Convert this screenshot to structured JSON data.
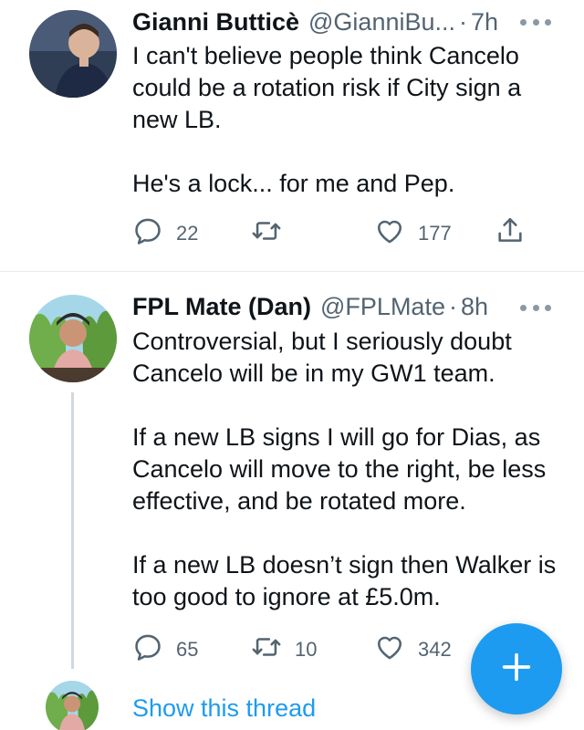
{
  "tweets": [
    {
      "name": "Gianni Butticè",
      "handle": "@GianniBu...",
      "separator": "·",
      "time": "7h",
      "paragraphs": [
        "I can't believe people think Cancelo could be a rotation risk if City sign a new LB.",
        "He's a lock... for me and Pep."
      ],
      "replies": "22",
      "retweets": "",
      "likes": "177"
    },
    {
      "name": "FPL Mate (Dan)",
      "handle": "@FPLMate",
      "separator": "·",
      "time": "8h",
      "paragraphs": [
        "Controversial, but I seriously doubt Cancelo will be in my GW1 team.",
        "If a new LB signs I will go for Dias, as Cancelo will move to the right, be less effective, and be rotated more.",
        "If a new LB doesn’t sign then Walker is too good to ignore at £5.0m."
      ],
      "replies": "65",
      "retweets": "10",
      "likes": "342"
    }
  ],
  "thread": {
    "show_label": "Show this thread"
  },
  "icons": {
    "more": "more-icon",
    "reply": "reply-icon",
    "retweet": "retweet-icon",
    "like": "heart-icon",
    "share": "share-icon",
    "compose": "plus-icon"
  },
  "colors": {
    "accent": "#1d9bf0",
    "text": "#0f1419",
    "muted": "#536471",
    "divider": "#e6ecf0",
    "thread_line": "#cfd9de"
  }
}
